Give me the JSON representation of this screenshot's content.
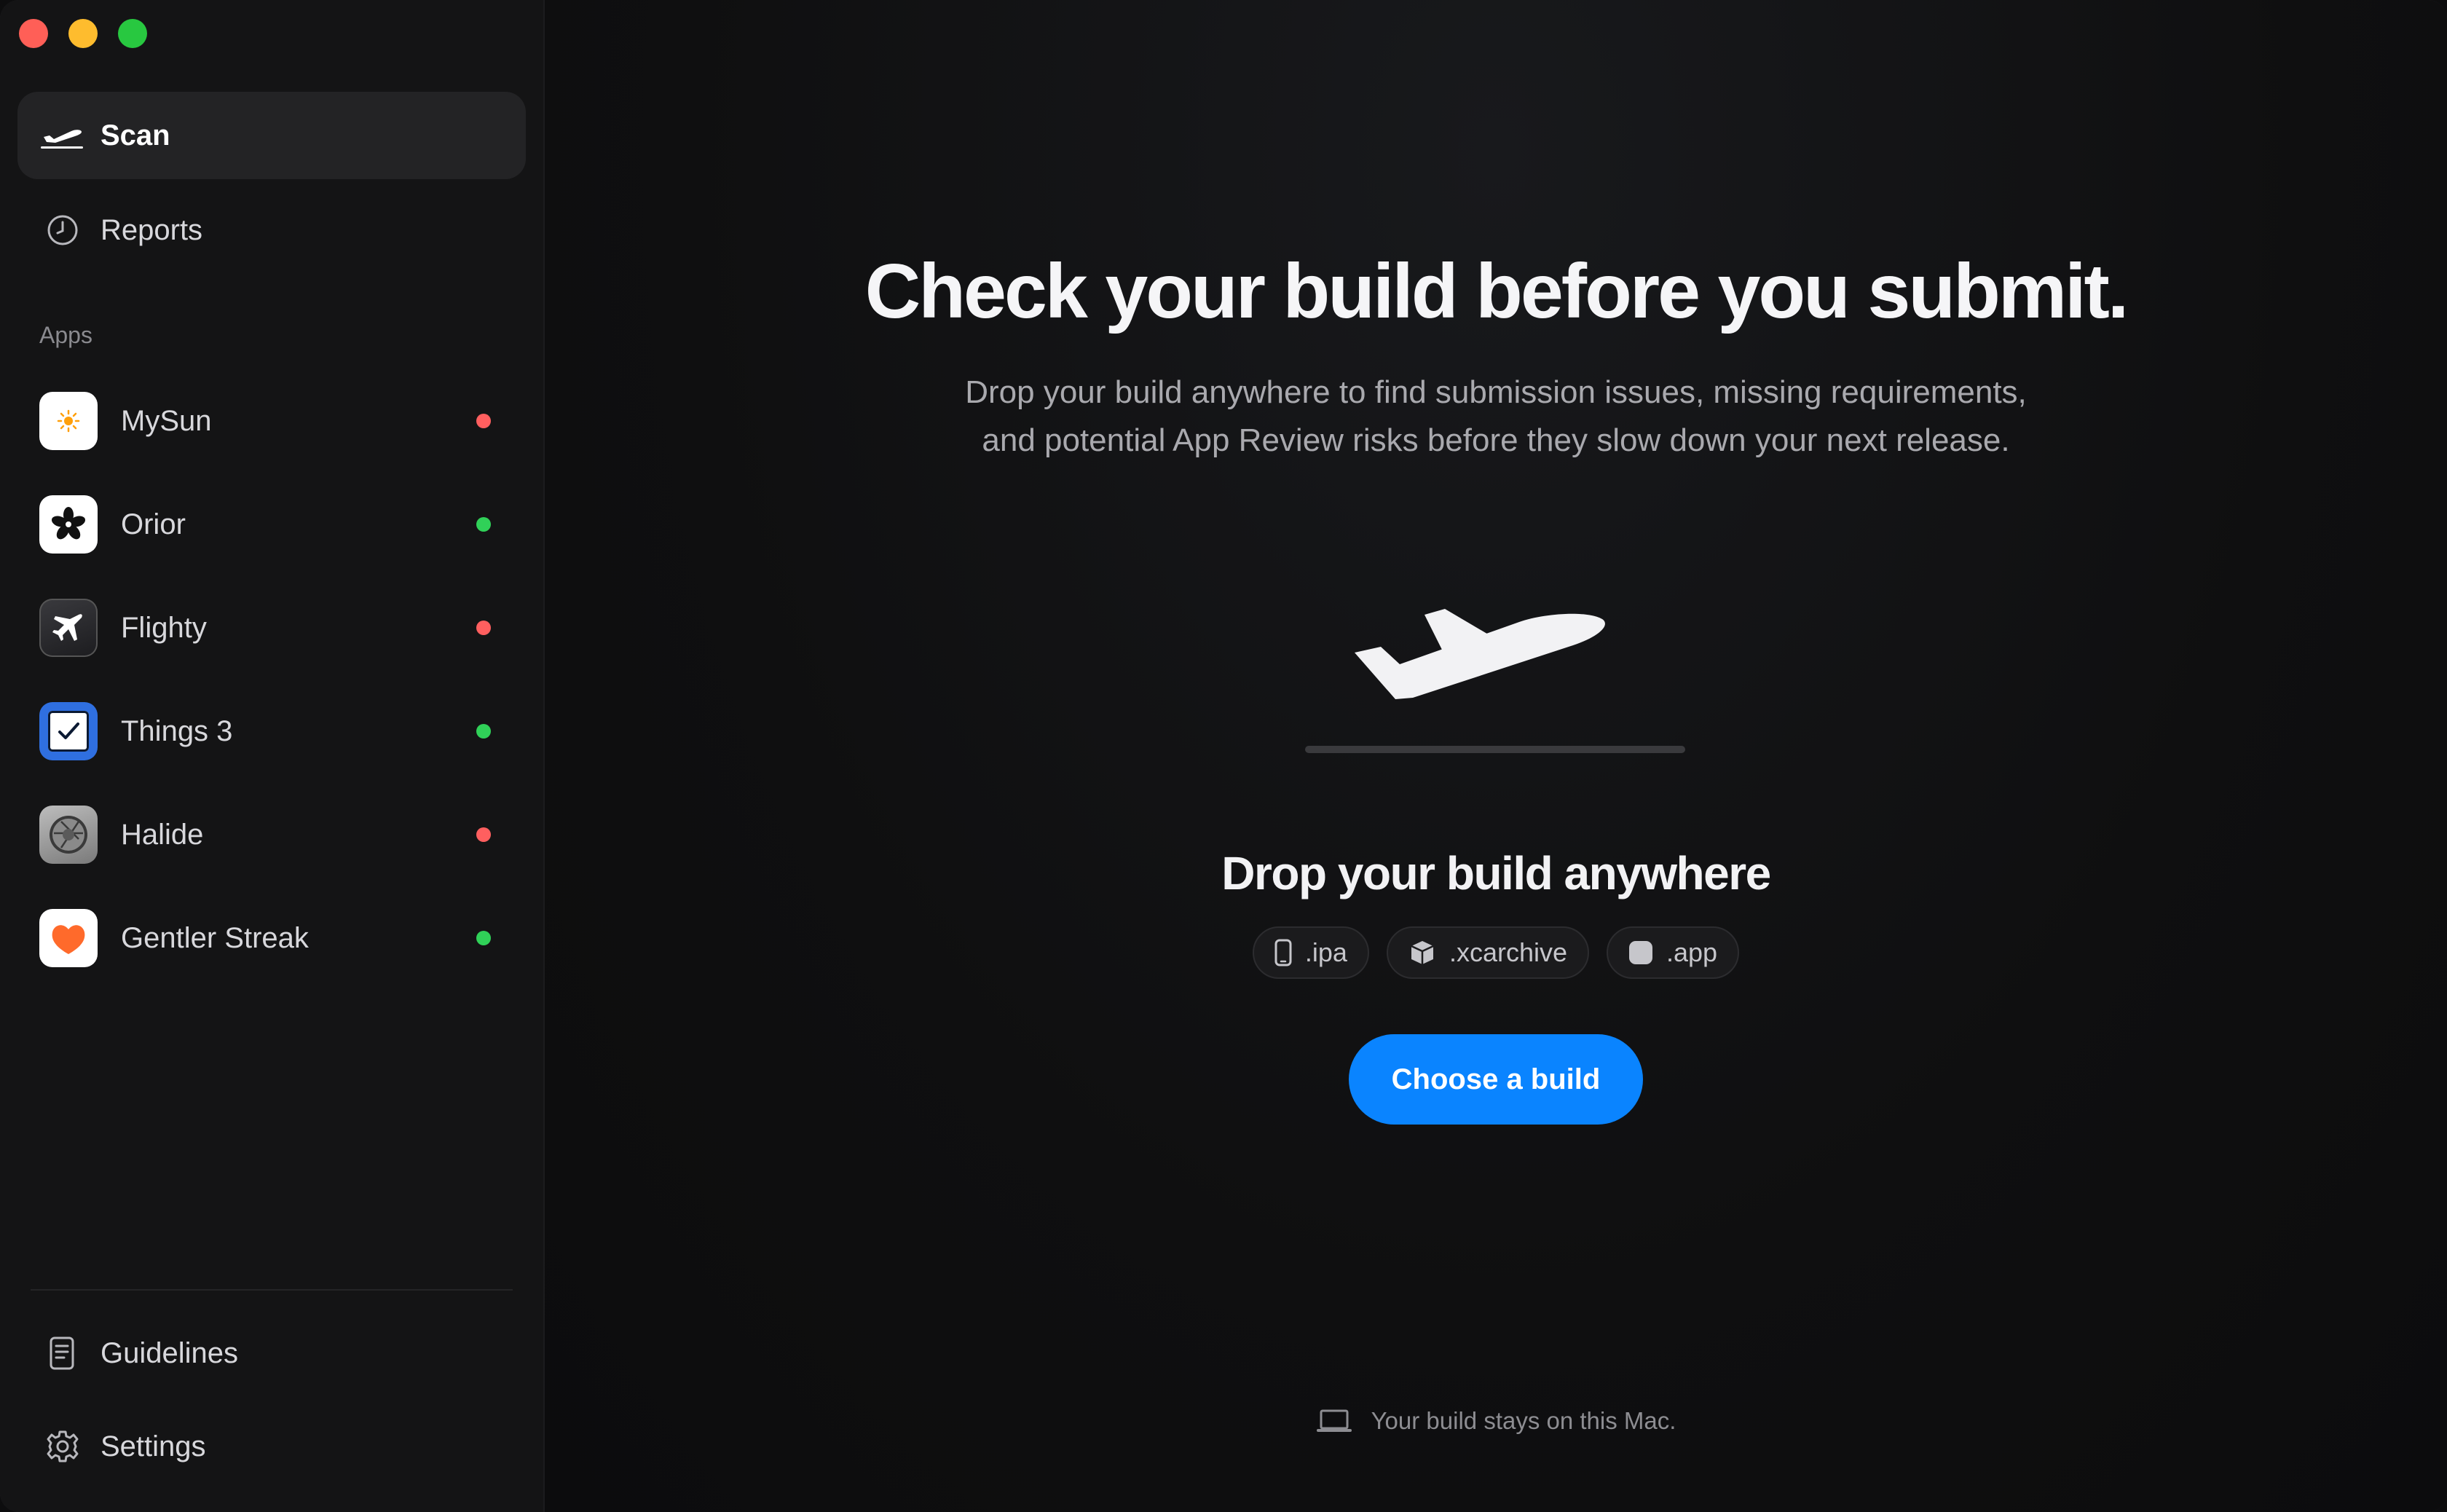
{
  "sidebar": {
    "nav": [
      {
        "label": "Scan",
        "icon": "airplane-departure-icon",
        "active": true
      },
      {
        "label": "Reports",
        "icon": "clock-icon",
        "active": false
      }
    ],
    "apps_label": "Apps",
    "apps": [
      {
        "name": "MySun",
        "status": "red"
      },
      {
        "name": "Orior",
        "status": "green"
      },
      {
        "name": "Flighty",
        "status": "red"
      },
      {
        "name": "Things 3",
        "status": "green"
      },
      {
        "name": "Halide",
        "status": "red"
      },
      {
        "name": "Gentler Streak",
        "status": "green"
      }
    ],
    "footer": [
      {
        "label": "Guidelines",
        "icon": "document-icon"
      },
      {
        "label": "Settings",
        "icon": "gear-icon"
      }
    ]
  },
  "main": {
    "headline": "Check your build before you submit.",
    "subtext_line1": "Drop your build anywhere to find submission issues, missing requirements,",
    "subtext_line2": "and potential App Review risks before they slow down your next release.",
    "drop_title": "Drop your build anywhere",
    "formats": [
      {
        "label": ".ipa",
        "icon": "phone-icon"
      },
      {
        "label": ".xcarchive",
        "icon": "box-icon"
      },
      {
        "label": ".app",
        "icon": "app-icon"
      }
    ],
    "cta_label": "Choose a build",
    "footer_note": "Your build stays on this Mac."
  },
  "colors": {
    "accent": "#0a84ff",
    "status_red": "#ff5f5f",
    "status_green": "#30d158"
  }
}
